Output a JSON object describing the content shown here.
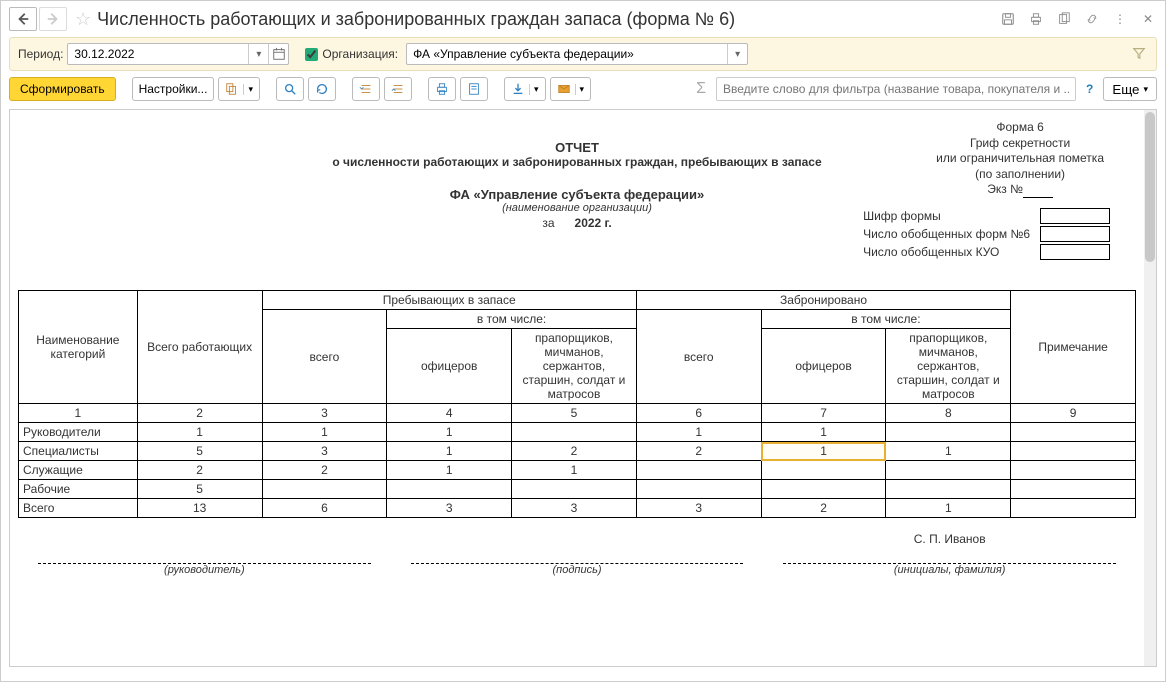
{
  "header": {
    "title": "Численность работающих и забронированных граждан запаса (форма № 6)"
  },
  "period": {
    "label": "Период:",
    "value": "30.12.2022",
    "org_label": "Организация:",
    "org_value": "ФА «Управление субъекта федерации»"
  },
  "toolbar": {
    "form_label": "Сформировать",
    "settings_label": "Настройки...",
    "more_label": "Еще",
    "filter_placeholder": "Введите слово для фильтра (название товара, покупателя и ..."
  },
  "form_meta": {
    "line1": "Форма 6",
    "line2": "Гриф секретности",
    "line3": "или ограничительная пометка",
    "line4": "(по заполнении)",
    "ekz_label": "Экз №"
  },
  "report": {
    "title1": "ОТЧЕТ",
    "title2": "о численности работающих и забронированных граждан, пребывающих в запасе",
    "org_name": "ФА «Управление субъекта федерации»",
    "org_caption": "(наименование организации)",
    "year_prefix": "за",
    "year": "2022 г."
  },
  "side": {
    "row1": "Шифр формы",
    "row2": "Число обобщенных форм №6",
    "row3": "Число обобщенных КУО"
  },
  "table": {
    "h_name": "Наименование категорий",
    "h_total": "Всего работающих",
    "h_reserve": "Пребывающих в запасе",
    "h_booked": "Забронировано",
    "h_note": "Примечание",
    "h_including": "в том числе:",
    "h_all": "всего",
    "h_officers": "офицеров",
    "h_other": "прапорщиков, мичманов, сержантов, старшин, солдат и матросов",
    "num_row": [
      "1",
      "2",
      "3",
      "4",
      "5",
      "6",
      "7",
      "8",
      "9"
    ],
    "rows": [
      {
        "name": "Руководители",
        "v": [
          "1",
          "1",
          "1",
          "",
          "1",
          "1",
          "",
          ""
        ]
      },
      {
        "name": "Специалисты",
        "v": [
          "5",
          "3",
          "1",
          "2",
          "2",
          "1",
          "1",
          ""
        ]
      },
      {
        "name": "Служащие",
        "v": [
          "2",
          "2",
          "1",
          "1",
          "",
          "",
          "",
          ""
        ]
      },
      {
        "name": "Рабочие",
        "v": [
          "5",
          "",
          "",
          "",
          "",
          "",
          "",
          ""
        ]
      },
      {
        "name": "Всего",
        "v": [
          "13",
          "6",
          "3",
          "3",
          "3",
          "2",
          "1",
          ""
        ]
      }
    ]
  },
  "sign": {
    "name": "С. П. Иванов",
    "c1": "(руководитель)",
    "c2": "(подпись)",
    "c3": "(инициалы, фамилия)"
  }
}
